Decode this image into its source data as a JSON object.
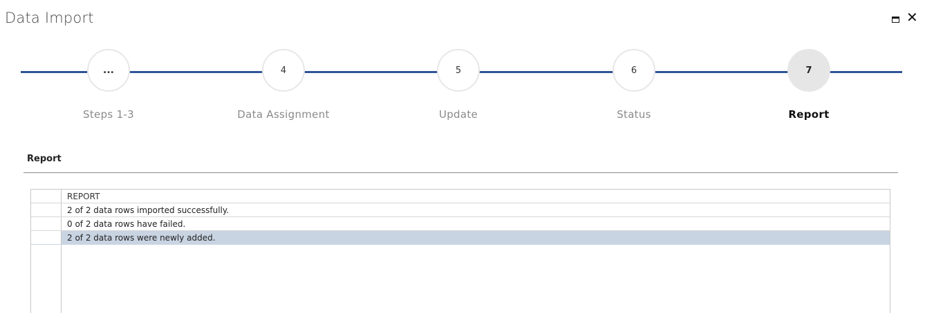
{
  "window": {
    "title": "Data Import",
    "maximize_icon": "maximize-icon",
    "close_icon": "close-icon",
    "close_glyph": "✕"
  },
  "wizard": {
    "accent_color": "#2f5496",
    "steps": [
      {
        "number": "...",
        "label": "Steps 1-3",
        "active": false
      },
      {
        "number": "4",
        "label": "Data Assignment",
        "active": false
      },
      {
        "number": "5",
        "label": "Update",
        "active": false
      },
      {
        "number": "6",
        "label": "Status",
        "active": false
      },
      {
        "number": "7",
        "label": "Report",
        "active": true
      }
    ]
  },
  "report_section": {
    "title": "Report",
    "grid": {
      "column_header": "REPORT",
      "rows": [
        {
          "text": "2 of 2 data rows imported successfully.",
          "selected": false
        },
        {
          "text": "0 of 2 data rows have failed.",
          "selected": false
        },
        {
          "text": "2 of 2 data rows were newly added.",
          "selected": true
        }
      ],
      "selected_row_color": "#c9d4e2"
    }
  }
}
